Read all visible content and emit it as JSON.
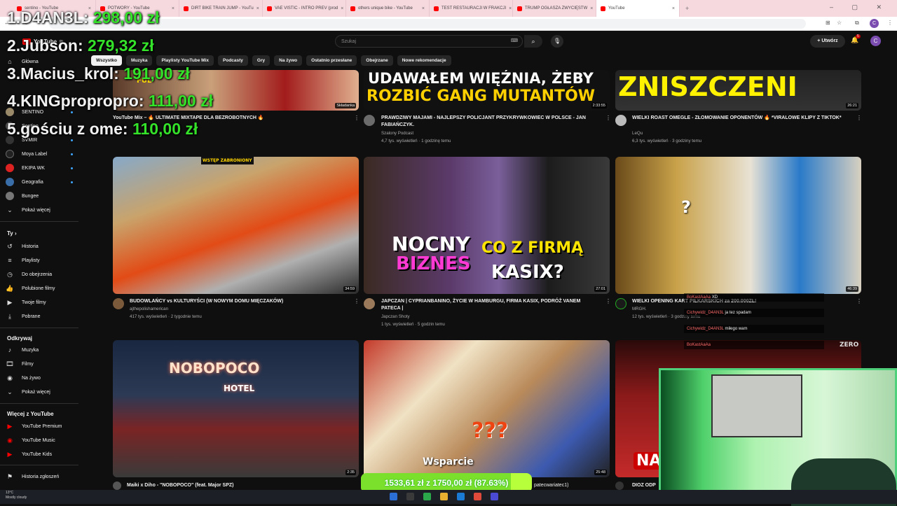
{
  "browser": {
    "tabs": [
      {
        "label": "sentino - YouTube"
      },
      {
        "label": "POTWORY - YouTube"
      },
      {
        "label": "DIRT BIKE TRAIN JUMP - YouTu"
      },
      {
        "label": "VAE VISTIC - INTRO PREV (prod"
      },
      {
        "label": "others unique bike - YouTube"
      },
      {
        "label": "TEST RESTAURACJI W FRAKCJI"
      },
      {
        "label": "TRUMP OGŁASZA ZWYCIĘSTW"
      },
      {
        "label": "YouTube"
      }
    ],
    "profile_initial": "C"
  },
  "youtube": {
    "logo_text": "YouTube",
    "logo_country": "PL",
    "search_placeholder": "Szukaj",
    "create_label": "Utwórz",
    "notif_count": "5",
    "avatar_initial": "C",
    "chips": [
      "Wszystko",
      "Muzyka",
      "Playlisty YouTube Mix",
      "Podcasty",
      "Gry",
      "Na żywo",
      "Ostatnio przesłane",
      "Obejrzane",
      "Nowe rekomendacje"
    ]
  },
  "sidebar": {
    "home": "Główna",
    "subs": [
      "SENTINO",
      "Sentino",
      "SVMIR",
      "Moya Label",
      "EKIPA WK",
      "Geografia",
      "Bungee"
    ],
    "more": "Pokaż więcej",
    "you_header": "Ty",
    "you_items": [
      "Historia",
      "Playlisty",
      "Do obejrzenia",
      "Polubione filmy",
      "Twoje filmy",
      "Pobrane"
    ],
    "explore_header": "Odkrywaj",
    "explore_items": [
      "Muzyka",
      "Filmy",
      "Na żywo",
      "Pokaż więcej"
    ],
    "more_header": "Więcej z YouTube",
    "more_items": [
      "YouTube Premium",
      "YouTube Music",
      "YouTube Kids"
    ],
    "report": "Historia zgłoszeń"
  },
  "videos": [
    {
      "title": "YouTube Mix – 🔥 ULTIMATE MIXTAPE DLA BEZROBOTNYCH 🔥",
      "channel": "",
      "stats": "",
      "duration": "Składanka",
      "thumb_text": "FUL"
    },
    {
      "title": "PRAWDZIWY MAJAMI - NAJLEPSZY POLICJANT PRZYKRYWKOWIEC W POLSCE - JAN FABIAŃCZYK.",
      "channel": "Szalony Podcast",
      "stats": "4,7 tys. wyświetleń · 1 godzinę temu",
      "duration": "2:33:55",
      "thumb_text1": "UDAWAŁEM WIĘŹNIA, ŻEBY",
      "thumb_text2": "ROZBIĆ GANG MUTANTÓW"
    },
    {
      "title": "WIELKI ROAST OMEGLE - ZŁOMOWANIE OPONENTÓW 🔥 *VIRALOWE KLIPY Z TIKTOK*",
      "channel": "LeQu",
      "stats": "6,3 tys. wyświetleń · 3 godziny temu",
      "duration": "26:21",
      "thumb_text": "ZNISZCZENI"
    },
    {
      "title": "BUDOWLAŃCY vs KULTURYŚCI (W NOWYM DOMU MIĘCZAKÓW)",
      "channel": "ajthepolishamerican",
      "stats": "417 tys. wyświetleń · 2 tygodnie temu",
      "duration": "34:59",
      "thumb_text": "WSTĘP ZABRONIONY"
    },
    {
      "title": "JAPCZAN | CYPRIANBANINO, ŻYCIE W HAMBURGU, FIRMA KASIX, PODRÓŻ VANEM PATECA |",
      "channel": "Japczan Shoty",
      "stats": "1 tys. wyświetleń · 5 godzin temu",
      "duration": "27:01",
      "thumb_text1": "NOCNY",
      "thumb_text2": "BIZNES",
      "thumb_text3": "CO Z FIRMĄ",
      "thumb_text4": "KASIX?"
    },
    {
      "title": "WIELKI OPENING KART PIŁKARSKICH za 200.000ZŁ!",
      "channel": "MRGH.",
      "stats": "12 tys. wyświetleń · 3 godziny temu",
      "duration": "46:39",
      "thumb_text": "?"
    },
    {
      "title": "Maiki x Diho - \"NOBOPOCO\" (feat. Major SPZ)",
      "duration": "2:35",
      "thumb_text1": "NOBOPOCO",
      "thumb_text2": "HOTEL"
    },
    {
      "title": "patecwariatec1)",
      "duration": "25:48",
      "thumb_text": "Wsparcie",
      "thumb_q": "???"
    },
    {
      "title": "DIOZ ODP",
      "duration": "",
      "thumb_text": "ZERO",
      "thumb_na": "NA"
    }
  ],
  "overlay": {
    "leaderboard": [
      {
        "name": "1.D4AN3L:",
        "amount": "298,00 zł"
      },
      {
        "name": "2.Jubson:",
        "amount": "279,32 zł"
      },
      {
        "name": "3.Macius_krol:",
        "amount": "191,00 zł"
      },
      {
        "name": "4.KINGpropropro:",
        "amount": "111,00 zł"
      },
      {
        "name": "5.gościu z ome:",
        "amount": "110,00 zł"
      }
    ],
    "chat": [
      {
        "user": "BoKastAaAa",
        "msg": "XD"
      },
      {
        "user": "Cichywidz_D4AN3L",
        "msg": "ja tez spadam"
      },
      {
        "user": "Cichywidz_D4AN3L",
        "msg": "miłego wam"
      },
      {
        "user": "BoKastAaAa",
        "msg": ""
      }
    ],
    "goal_text": "1533,61 zł z 1750,00 zł (87.63%)",
    "goal_fraction": 0.8763
  },
  "taskbar": {
    "temp": "13°C",
    "weather": "Mostly cloudy"
  }
}
